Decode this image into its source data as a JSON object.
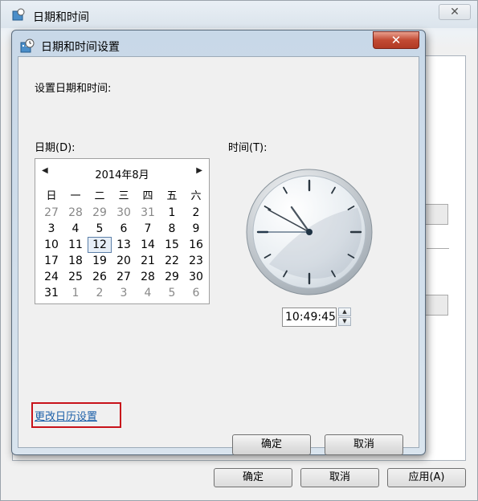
{
  "parent": {
    "title": "日期和时间",
    "close_label": "✕",
    "ok_label": "确定",
    "cancel_label": "取消",
    "apply_label": "应用(A)"
  },
  "dialog": {
    "title": "日期和时间设置",
    "close_label": "✕",
    "heading": "设置日期和时间:",
    "date_label": "日期(D):",
    "time_label": "时间(T):",
    "calendar": {
      "prev": "◀",
      "next": "▶",
      "month_title": "2014年8月",
      "weekdays": [
        "日",
        "一",
        "二",
        "三",
        "四",
        "五",
        "六"
      ],
      "weeks": [
        [
          "27",
          "28",
          "29",
          "30",
          "31",
          "1",
          "2"
        ],
        [
          "3",
          "4",
          "5",
          "6",
          "7",
          "8",
          "9"
        ],
        [
          "10",
          "11",
          "12",
          "13",
          "14",
          "15",
          "16"
        ],
        [
          "17",
          "18",
          "19",
          "20",
          "21",
          "22",
          "23"
        ],
        [
          "24",
          "25",
          "26",
          "27",
          "28",
          "29",
          "30"
        ],
        [
          "31",
          "1",
          "2",
          "3",
          "4",
          "5",
          "6"
        ]
      ],
      "selected_day": "12"
    },
    "clock": {
      "hour": 10,
      "minute": 49,
      "second": 45
    },
    "time_value": "10:49:45",
    "spin_up": "▲",
    "spin_down": "▼",
    "calendar_link": "更改日历设置",
    "ok_label": "确定",
    "cancel_label": "取消"
  }
}
